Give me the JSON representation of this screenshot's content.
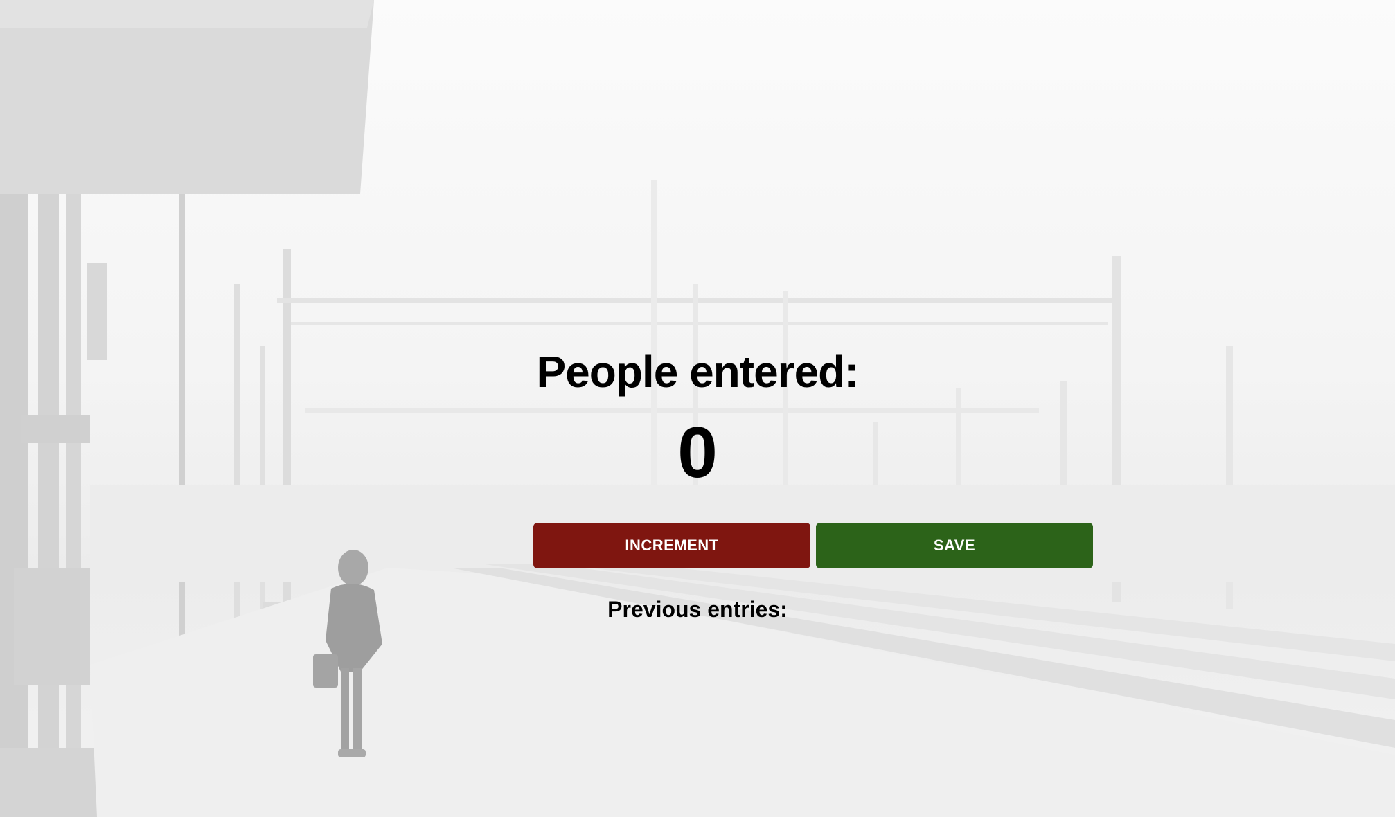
{
  "counter": {
    "title": "People entered:",
    "count": "0",
    "increment_label": "INCREMENT",
    "save_label": "SAVE",
    "previous_heading": "Previous entries:",
    "previous_entries": ""
  },
  "theme": {
    "increment_color": "#7f1610",
    "save_color": "#2c6319",
    "text_color": "#000000"
  }
}
